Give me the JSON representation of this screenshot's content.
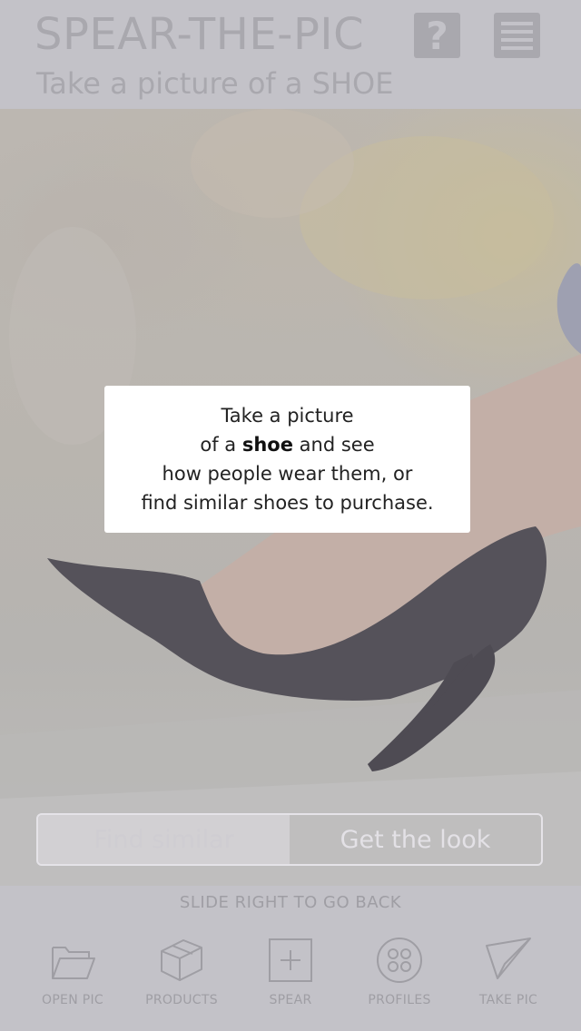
{
  "header": {
    "title": "SPEAR-THE-PIC",
    "subtitle": "Take a picture of a SHOE",
    "help_glyph": "?",
    "help_icon": "question-icon",
    "menu_icon": "hamburger-menu-icon"
  },
  "dialog": {
    "line1": "Take a picture",
    "line2_pre": "of a ",
    "line2_bold": "shoe",
    "line2_post": " and see",
    "line3": "how people wear them, or",
    "line4": "find similar shoes to purchase."
  },
  "actions": {
    "find_similar": "Find similar",
    "get_the_look": "Get the look"
  },
  "hint": "SLIDE RIGHT TO GO BACK",
  "tabs": [
    {
      "label": "OPEN PIC",
      "icon": "folder-icon"
    },
    {
      "label": "PRODUCTS",
      "icon": "box-icon"
    },
    {
      "label": "SPEAR",
      "icon": "plus-square-icon"
    },
    {
      "label": "PROFILES",
      "icon": "profiles-circle-icon"
    },
    {
      "label": "TAKE PIC",
      "icon": "paper-plane-icon"
    }
  ],
  "colors": {
    "overlay": "#c3c2c8",
    "muted_text": "#a9a8ae",
    "dialog_bg": "#ffffff"
  }
}
